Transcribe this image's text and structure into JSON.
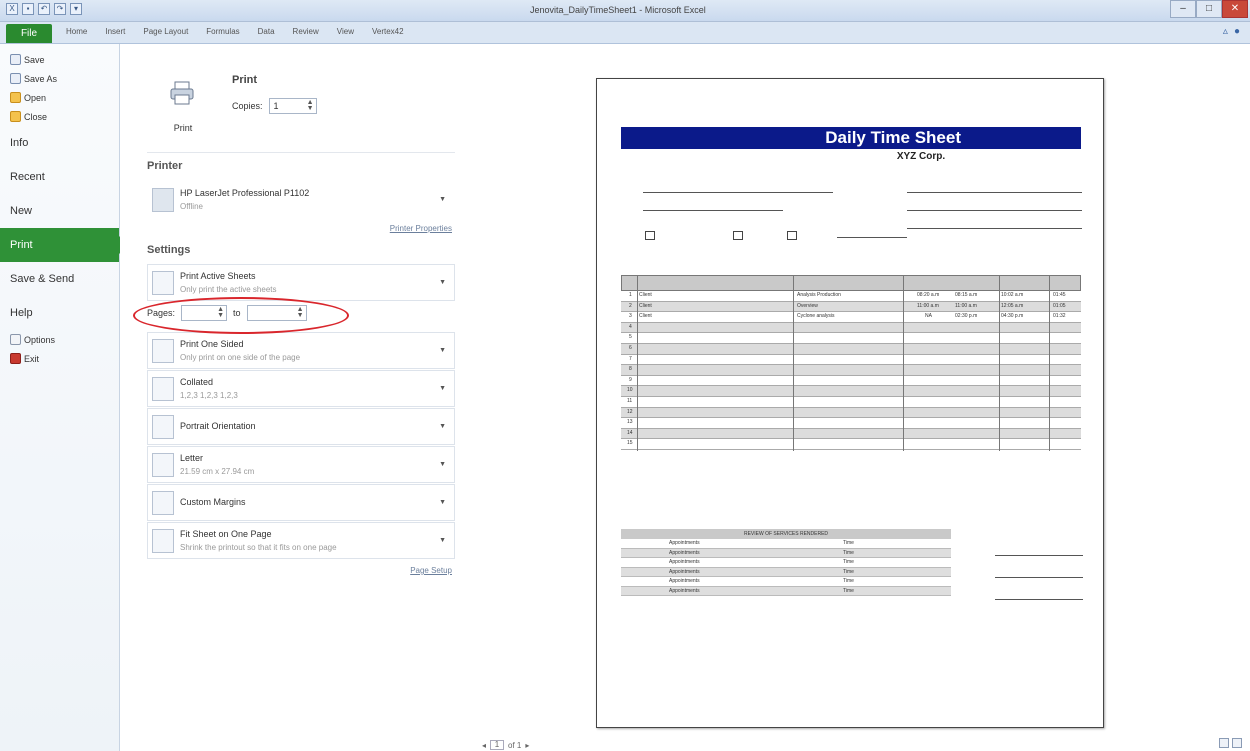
{
  "window": {
    "title": "Jenovita_DailyTimeSheet1 - Microsoft Excel",
    "min": "–",
    "max": "□",
    "close": "✕"
  },
  "ribbon": {
    "file_tab": "File",
    "tabs": [
      "Home",
      "Insert",
      "Page Layout",
      "Formulas",
      "Data",
      "Review",
      "View",
      "Vertex42"
    ]
  },
  "backstage": {
    "commands": [
      {
        "label": "Save",
        "icon": "save-icon"
      },
      {
        "label": "Save As",
        "icon": "save-as-icon"
      },
      {
        "label": "Open",
        "icon": "open-folder-icon"
      },
      {
        "label": "Close",
        "icon": "close-folder-icon"
      }
    ],
    "nav": [
      "Info",
      "Recent",
      "New",
      "Print",
      "Save & Send",
      "Help"
    ],
    "selected": "Print",
    "options_label": "Options",
    "exit_label": "Exit"
  },
  "print": {
    "button_label": "Print",
    "header": "Print",
    "copies_label": "Copies:",
    "copies_value": "1",
    "printer_section": "Printer",
    "printer_name": "HP LaserJet Professional P1102",
    "printer_status": "Offline",
    "printer_properties": "Printer Properties",
    "settings_section": "Settings",
    "settings": [
      {
        "title": "Print Active Sheets",
        "desc": "Only print the active sheets"
      },
      {
        "title": "Print One Sided",
        "desc": "Only print on one side of the page"
      },
      {
        "title": "Collated",
        "desc": "1,2,3   1,2,3   1,2,3"
      },
      {
        "title": "Portrait Orientation",
        "desc": ""
      },
      {
        "title": "Letter",
        "desc": "21.59 cm x 27.94 cm"
      },
      {
        "title": "Custom Margins",
        "desc": ""
      },
      {
        "title": "Fit Sheet on One Page",
        "desc": "Shrink the printout so that it fits on one page"
      }
    ],
    "pages_label": "Pages:",
    "pages_to": "to",
    "page_setup": "Page Setup"
  },
  "sheet": {
    "title": "Daily Time Sheet",
    "company": "XYZ Corp.",
    "rows": [
      {
        "num": "1",
        "client": "Client",
        "service": "Analysis Production",
        "a": "08:20 a.m",
        "b": "08:15 a.m",
        "c": "10:02 a.m",
        "d": "01:45"
      },
      {
        "num": "2",
        "client": "Client",
        "service": "Overview",
        "a": "11:00 a.m",
        "b": "11:00 a.m",
        "c": "12:05 a.m",
        "d": "01:05"
      },
      {
        "num": "3",
        "client": "Client",
        "service": "Cyclone analysis",
        "a": "NA",
        "b": "02:30 p.m",
        "c": "04:30 p.m",
        "d": "01:32"
      },
      {
        "num": "4"
      },
      {
        "num": "5"
      },
      {
        "num": "6"
      },
      {
        "num": "7"
      },
      {
        "num": "8"
      },
      {
        "num": "9"
      },
      {
        "num": "10"
      },
      {
        "num": "11"
      },
      {
        "num": "12"
      },
      {
        "num": "13"
      },
      {
        "num": "14"
      },
      {
        "num": "15"
      }
    ],
    "summary_header": "REVIEW OF SERVICES RENDERED",
    "summary_rows": [
      {
        "a": "Appointments",
        "b": "Time"
      },
      {
        "a": "Appointments",
        "b": "Time"
      },
      {
        "a": "Appointments",
        "b": "Time"
      },
      {
        "a": "Appointments",
        "b": "Time"
      },
      {
        "a": "Appointments",
        "b": "Time"
      },
      {
        "a": "Appointments",
        "b": "Time"
      }
    ]
  },
  "pager": {
    "current": "1",
    "total": "of 1"
  }
}
